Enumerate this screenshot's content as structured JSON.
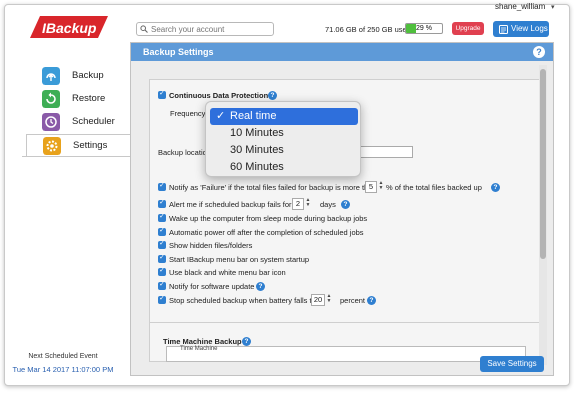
{
  "header": {
    "logo_text": "IBackup",
    "search_placeholder": "Search your account",
    "username": "shane_william",
    "usage_text": "71.06 GB of 250 GB used",
    "usage_percent_label": "29 %",
    "usage_fraction": 0.29,
    "upgrade_label": "Upgrade",
    "view_logs_label": "View Logs"
  },
  "sidebar": {
    "items": [
      {
        "label": "Backup",
        "icon": "backup-icon",
        "color": "#3a9bd8"
      },
      {
        "label": "Restore",
        "icon": "restore-icon",
        "color": "#3eae55"
      },
      {
        "label": "Scheduler",
        "icon": "scheduler-icon",
        "color": "#8a5aa8"
      },
      {
        "label": "Settings",
        "icon": "settings-icon",
        "color": "#e8a21c"
      }
    ],
    "active_index": 3,
    "next_event_label": "Next Scheduled Event",
    "next_event_value": "Tue Mar 14 2017 11:07:00 PM"
  },
  "panel": {
    "title": "Backup Settings",
    "cdp_label": "Continuous Data Protection",
    "frequency_label": "Frequency",
    "frequency_options": [
      "Real time",
      "10 Minutes",
      "30 Minutes",
      "60 Minutes"
    ],
    "frequency_selected": "Real time",
    "backup_location_label": "Backup location",
    "options": {
      "notify_failure_pre": "Notify as 'Failure' if the total files failed for backup is more tha",
      "notify_failure_value": "5",
      "notify_failure_post": "% of the total files backed up",
      "alert_pre": "Alert me if scheduled backup fails for",
      "alert_value": "2",
      "alert_post": "days",
      "wake": "Wake up the computer from sleep mode during backup jobs",
      "power_off": "Automatic power off after the completion of scheduled jobs",
      "hidden": "Show hidden files/folders",
      "startup": "Start IBackup menu bar on system startup",
      "bw_icon": "Use black and white menu bar icon",
      "notify_update": "Notify for software update",
      "battery_pre": "Stop scheduled backup when battery falls to",
      "battery_value": "20",
      "battery_post": "percent"
    },
    "time_machine_label": "Time Machine Backup",
    "time_machine_sub": "Time Machine",
    "save_label": "Save Settings"
  },
  "colors": {
    "accent": "#2f7fd0",
    "header_bar": "#5e9ad8",
    "upgrade": "#e04050",
    "usage_fill": "#4fbf3d"
  }
}
